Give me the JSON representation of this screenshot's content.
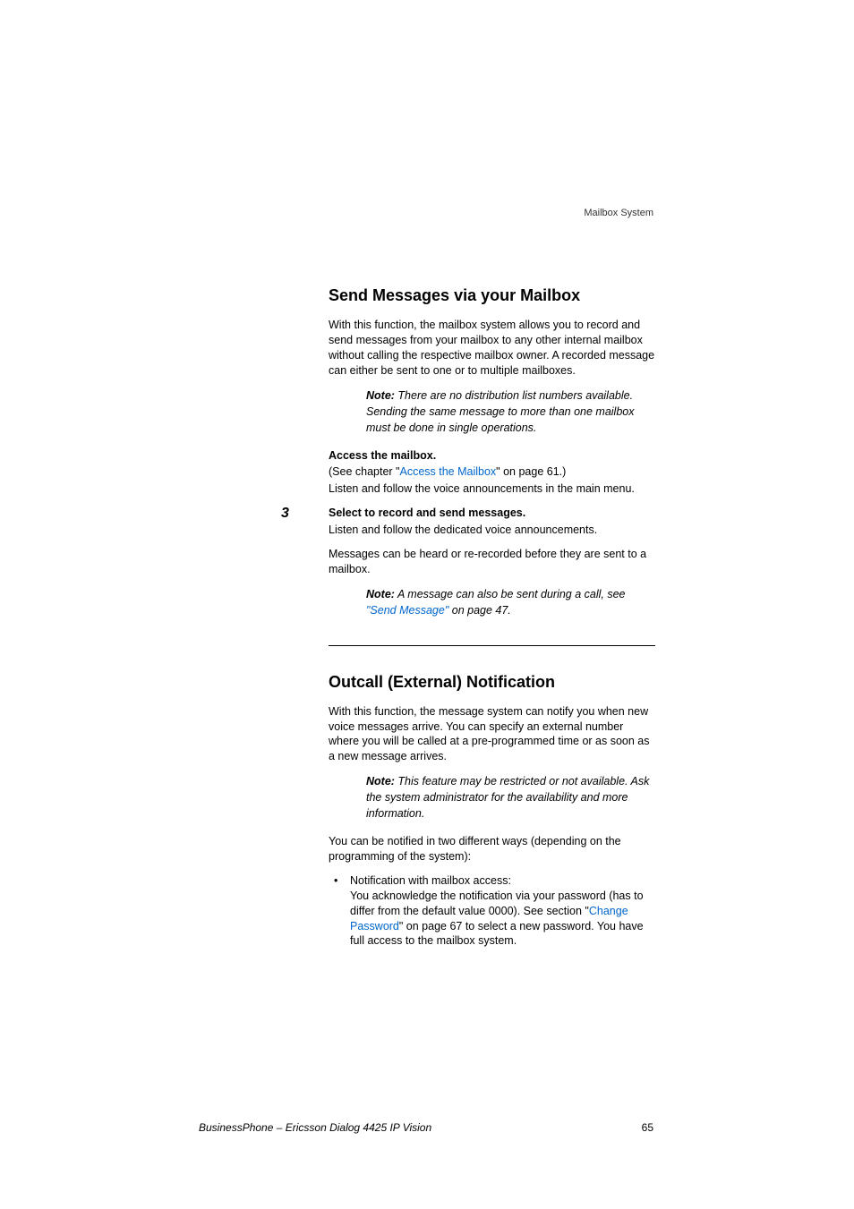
{
  "header": {
    "section": "Mailbox System"
  },
  "s1": {
    "title": "Send Messages via your Mailbox",
    "p1": "With this function, the mailbox system allows you to record and send messages from your mailbox to any other internal mailbox without calling the respective mailbox owner. A recorded message can either be sent to one or to multiple mailboxes.",
    "note1_label": "Note:",
    "note1_text": " There are no distribution list numbers available. Sending the same message to more than one mailbox must be done in single operations.",
    "step0_bold": "Access the mailbox.",
    "step0_l2a": "(See chapter \"",
    "step0_link": "Access the Mailbox",
    "step0_l2b": "\" on page 61.)",
    "step0_l3": "Listen and follow the voice announcements in the main menu.",
    "step3_num": "3",
    "step3_bold": "Select to record and send messages.",
    "step3_l2": "Listen and follow the dedicated voice announcements.",
    "step3_p2": "Messages can be heard or re-recorded before they are sent to a mailbox.",
    "note2_label": "Note:",
    "note2_texta": " A message can also be sent during a call, see ",
    "note2_link": "\"Send Message\"",
    "note2_textb": " on page 47."
  },
  "s2": {
    "title": "Outcall (External) Notification",
    "p1": "With this function, the message system can notify you when new voice messages arrive. You can specify an external number where you will be called at a pre-programmed time or as soon as a new message arrives.",
    "note_label": "Note:",
    "note_text": " This feature may be restricted or not available. Ask the system administrator for the availability and more information.",
    "p2": "You can be notified in two different ways (depending on the programming of the system):",
    "b1_l1": "Notification with mailbox access:",
    "b1_l2a": "You acknowledge the notification via your password (has to differ from the default value 0000). See section \"",
    "b1_link": "Change Password",
    "b1_l2b": "\" on page 67 to select a new password. You have full access to the mailbox system."
  },
  "footer": {
    "product": "BusinessPhone – Ericsson Dialog 4425 IP Vision",
    "page": "65"
  }
}
